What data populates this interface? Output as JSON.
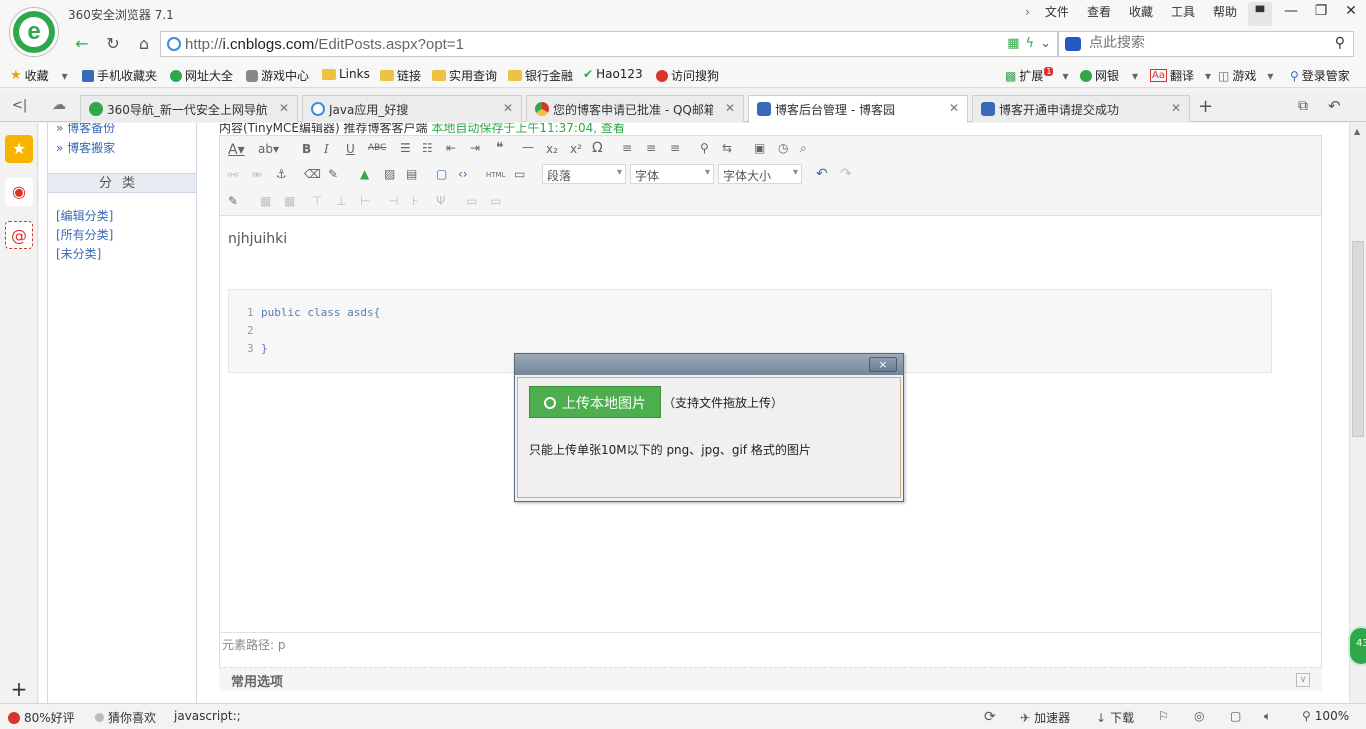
{
  "window": {
    "title": "360安全浏览器 7.1",
    "menu": [
      "文件",
      "查看",
      "收藏",
      "工具",
      "帮助"
    ]
  },
  "address": {
    "url_prefix": "http://",
    "url_host": "i.cnblogs.com",
    "url_path": "/EditPosts.aspx?opt=1",
    "search_placeholder": "点此搜索"
  },
  "bookmarks": {
    "left": [
      "收藏",
      "手机收藏夹",
      "网址大全",
      "游戏中心",
      "Links",
      "链接",
      "实用查询",
      "银行金融",
      "Hao123",
      "访问搜狗"
    ],
    "right": [
      "扩展",
      "网银",
      "翻译",
      "游戏",
      "登录管家"
    ],
    "ext_badge": "1"
  },
  "tabs": [
    {
      "label": "360导航_新一代安全上网导航",
      "active": false
    },
    {
      "label": "Java应用_好搜",
      "active": false
    },
    {
      "label": "您的博客申请已批准 - QQ邮箱",
      "active": false
    },
    {
      "label": "博客后台管理 - 博客园",
      "active": true
    },
    {
      "label": "博客开通申请提交成功",
      "active": false
    }
  ],
  "left_tree": {
    "links_top": [
      "» 博客备份",
      "» 博客搬家"
    ],
    "category_header": "分类",
    "category_links": [
      "[编辑分类]",
      "[所有分类]",
      "[未分类]"
    ]
  },
  "editor": {
    "header_text": "内容(TinyMCE编辑器) 推荐博客客户端",
    "autosave_text": "本地自动保存于上午11:37:04, 查看",
    "format_select": "段落",
    "font_select": "字体",
    "size_select": "字体大小",
    "body_text": "njhjuihki",
    "code_lines": [
      {
        "no": "1",
        "text": "public class asds{"
      },
      {
        "no": "2",
        "text": ""
      },
      {
        "no": "3",
        "text": "}"
      }
    ],
    "path_label": "元素路径: p",
    "common_options": "常用选项"
  },
  "dialog": {
    "upload_button": "上传本地图片",
    "drag_hint": "（支持文件拖放上传）",
    "note": "只能上传单张10M以下的 png、jpg、gif 格式的图片",
    "close": "×"
  },
  "statusbar": {
    "rating": "80%好评",
    "guess": "猜你喜欢",
    "status_text": "javascript:;",
    "accelerator": "加速器",
    "download": "下载",
    "zoom": "100%"
  },
  "badge": "43",
  "colors": {
    "brand_green": "#2ea84a",
    "upload_green": "#4cae4c",
    "link_blue": "#3a6ab5"
  }
}
